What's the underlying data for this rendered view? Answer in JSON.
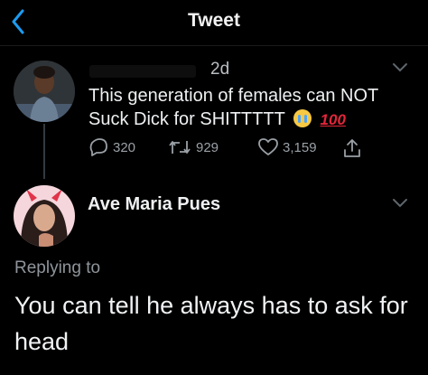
{
  "header": {
    "title": "Tweet"
  },
  "tweet": {
    "time": "2d",
    "line1": "This generation of females can NOT",
    "line2": "Suck Dick for SHITTTTT",
    "emoji_score": "100",
    "replies": "320",
    "retweets": "929",
    "likes": "3,159"
  },
  "reply": {
    "author": "Ave Maria Pues",
    "replying_label": "Replying to",
    "text": "You can tell he always has to ask for head"
  },
  "colors": {
    "accent": "#1d9bf0",
    "bg": "#000000",
    "muted": "#9aa0a6"
  }
}
